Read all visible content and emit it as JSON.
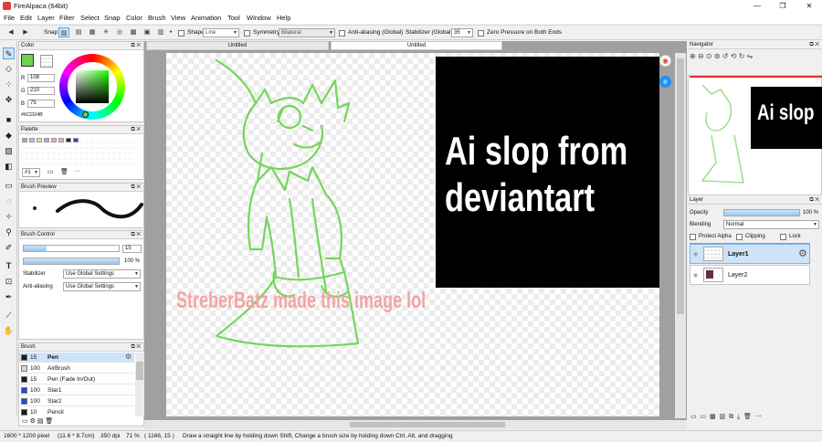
{
  "window": {
    "title": "FireAlpaca (64bit)",
    "minimize": "—",
    "maximize": "❐",
    "close": "✕"
  },
  "menu": [
    "File",
    "Edit",
    "Layer",
    "Filter",
    "Select",
    "Snap",
    "Color",
    "Brush",
    "View",
    "Animation",
    "Tool",
    "Window",
    "Help"
  ],
  "toolbar": {
    "snap_label": "Snap",
    "shape_label": "Shape",
    "shape_value": "Line",
    "symmetry_label": "Symmetry",
    "symmetry_value": "Bilateral",
    "antialias_label": "Anti-aliasing (Global)",
    "stabilizer_label": "Stabilizer (Global)",
    "stabilizer_value": "35",
    "zero_pressure_label": "Zero Pressure on Both Ends"
  },
  "color_panel": {
    "title": "Color",
    "r_label": "R",
    "r": "108",
    "g_label": "G",
    "g": "210",
    "b_label": "B",
    "b": "75",
    "hex": "#6CD24B",
    "current_color": "#6CD24B"
  },
  "palette_panel": {
    "title": "Palette",
    "index": "#1",
    "more": "···",
    "swatches": [
      "#c8a0a0",
      "#b0c0d8",
      "#e8d890",
      "#e090c0",
      "#f0a0e0",
      "#c0c0c0",
      "#202020",
      "#3040a0"
    ]
  },
  "brush_preview_panel": {
    "title": "Brush Preview"
  },
  "brush_control_panel": {
    "title": "Brush Control",
    "size": "15",
    "opacity": "100 %",
    "size_fraction": 0.24,
    "opacity_fraction": 1.0,
    "stabilizer_label": "Stabilizer",
    "stabilizer_value": "Use Global Settings",
    "antialias_label": "Anti-aliasing",
    "antialias_value": "Use Global Settings"
  },
  "brush_panel": {
    "title": "Brush",
    "items": [
      {
        "size": "15",
        "name": "Pen",
        "color": "#1a1a1a",
        "selected": true
      },
      {
        "size": "100",
        "name": "AirBrush",
        "color": "#d8d8d8",
        "selected": false
      },
      {
        "size": "15",
        "name": "Pen (Fade In/Out)",
        "color": "#1a1a1a",
        "selected": false
      },
      {
        "size": "100",
        "name": "Star1",
        "color": "#2848d0",
        "selected": false
      },
      {
        "size": "100",
        "name": "Star2",
        "color": "#2848d0",
        "selected": false
      },
      {
        "size": "10",
        "name": "Pencil",
        "color": "#1a1a1a",
        "selected": false
      }
    ]
  },
  "canvas": {
    "tab1": "Untitled",
    "tab2": "Untitled",
    "black_text_line1": "Ai slop from",
    "black_text_line2": "deviantart",
    "watermark": "StreberBatz made this image lol"
  },
  "navigator": {
    "title": "Navigator",
    "preview_text": "Ai slop"
  },
  "layer_panel": {
    "title": "Layer",
    "opacity_label": "Opacity",
    "opacity": "100 %",
    "blending_label": "Blending",
    "blending_value": "Normal",
    "protect_alpha": "Protect Alpha",
    "clipping": "Clipping",
    "lock": "Lock",
    "layers": [
      {
        "name": "Layer1",
        "selected": true
      },
      {
        "name": "Layer2",
        "selected": false
      }
    ]
  },
  "status": {
    "size": "1600 * 1200 pixel",
    "physical": "(11.6 * 8.7cm)",
    "dpi": "350 dpi",
    "zoom": "71 %",
    "coords": "( 1166, 15 )",
    "hint": "Draw a straight line by holding down Shift, Change a brush size by holding down Ctrl, Alt, and dragging"
  }
}
